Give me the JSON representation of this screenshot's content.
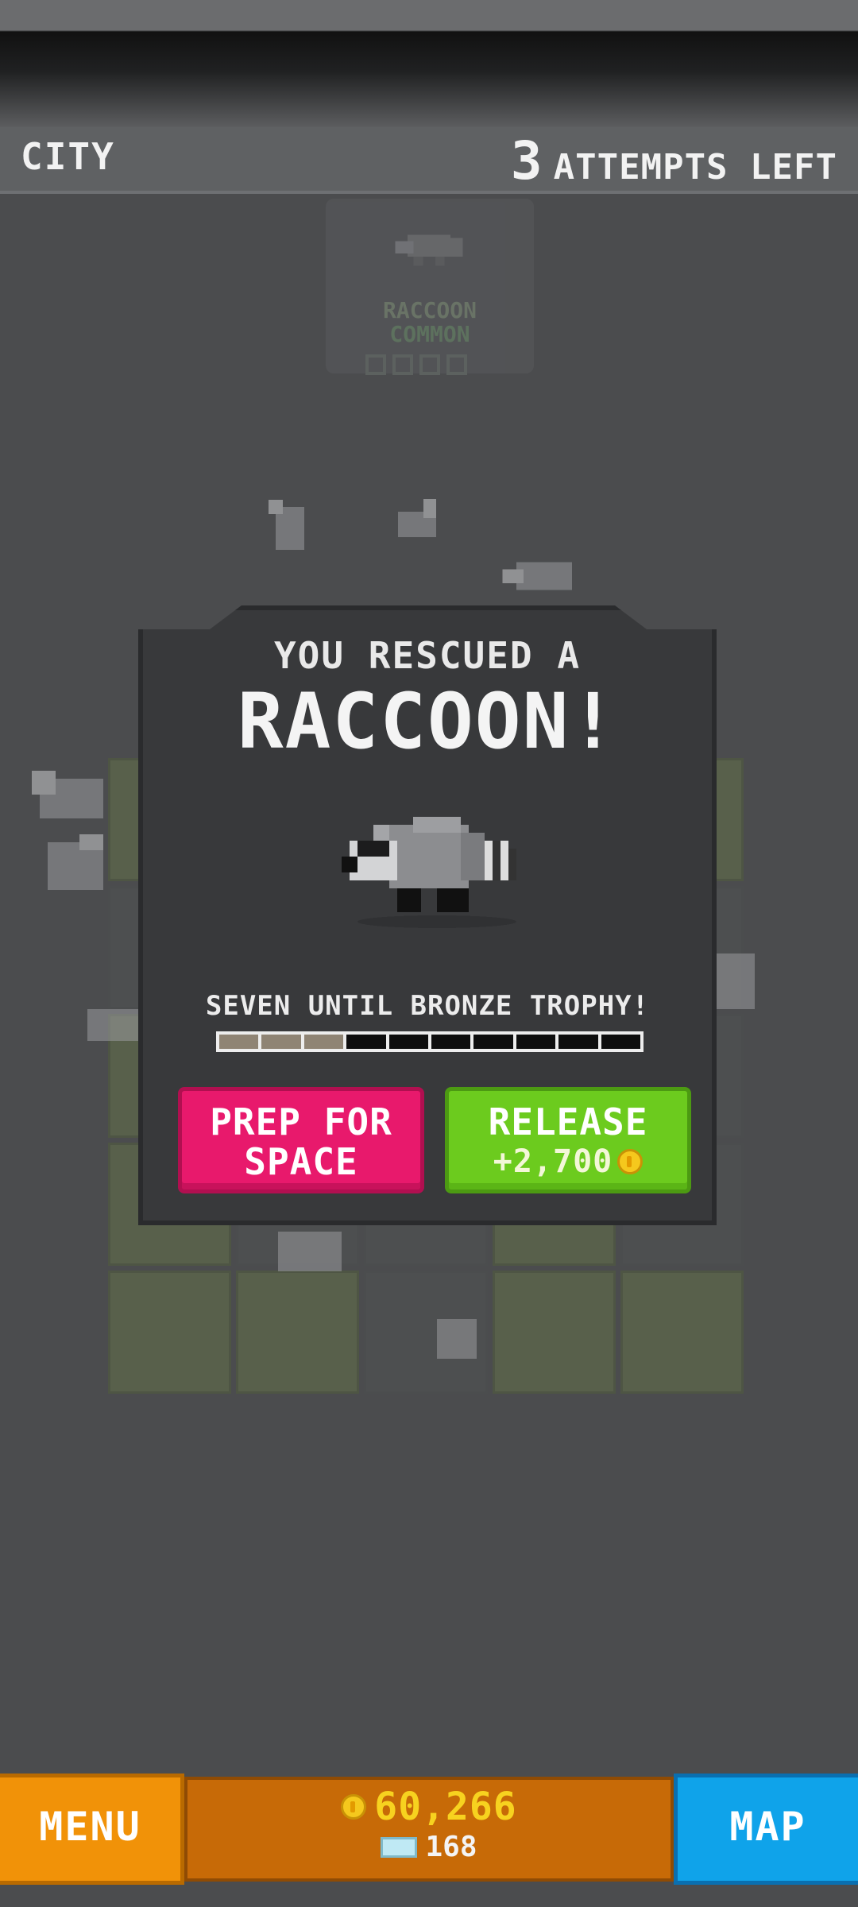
{
  "hud": {
    "level_name": "CITY",
    "attempts_count": "3",
    "attempts_label": "ATTEMPTS LEFT"
  },
  "background_card": {
    "name": "RACCOON",
    "rarity": "COMMON"
  },
  "modal": {
    "subtitle": "YOU RESCUED A",
    "title": "RACCOON!",
    "progress_text": "SEVEN UNTIL BRONZE TROPHY!",
    "progress": {
      "filled": 3,
      "total": 10
    },
    "prep_button": {
      "line1": "PREP FOR",
      "line2": "SPACE"
    },
    "release_button": {
      "line1": "RELEASE",
      "reward": "+2,700"
    }
  },
  "footer": {
    "menu_label": "MENU",
    "map_label": "MAP",
    "coins": "60,266",
    "gems": "168"
  },
  "colors": {
    "prep_button": "#e8196c",
    "release_button": "#6ccb1e",
    "menu_button": "#f19208",
    "map_button": "#0fa3ea",
    "currency_bar": "#c76a07",
    "coin_text": "#f7d21f"
  },
  "icons": [
    "coin-icon",
    "gem-icon",
    "raccoon-sprite"
  ]
}
